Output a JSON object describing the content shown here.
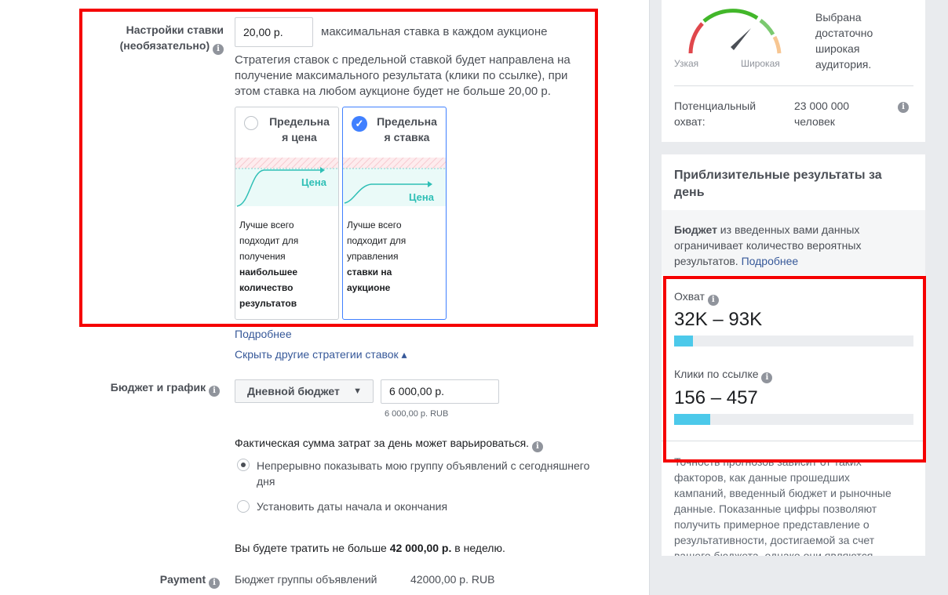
{
  "bid": {
    "label_line1": "Настройки ставки",
    "label_line2": "(необязательно)",
    "input_value": "20,00 р.",
    "input_suffix": "максимальная ставка в каждом аукционе",
    "description": [
      "Стратегия ставок с предельной ставкой будет направлена на",
      "получение максимального результата (клики по ссылке), при",
      "этом ставка на любом аукционе будет не больше 20,00 р."
    ],
    "cards": [
      {
        "title_line1": "Предельна",
        "title_line2": "я цена",
        "chart_label": "Цена",
        "desc_normal": [
          "Лучше всего",
          "подходит для",
          "получения"
        ],
        "desc_bold": [
          "наибольшее",
          "количество",
          "результатов"
        ],
        "selected": false
      },
      {
        "title_line1": "Предельна",
        "title_line2": "я ставка",
        "chart_label": "Цена",
        "desc_normal": [
          "Лучше всего",
          "подходит для",
          "управления"
        ],
        "desc_bold": [
          "ставки на",
          "аукционе"
        ],
        "selected": true
      }
    ],
    "more_link": "Подробнее",
    "hide_link": "Скрыть другие стратегии ставок ▴"
  },
  "budget": {
    "label": "Бюджет и график",
    "dropdown_value": "Дневной бюджет",
    "amount": "6 000,00 р.",
    "amount_sub": "6 000,00 р. RUB",
    "note": "Фактическая сумма затрат за день может варьироваться.",
    "options": [
      {
        "line1": "Непрерывно показывать мою группу объявлений с сегодняшнего",
        "line2": "дня",
        "selected": true
      },
      {
        "line1": "Установить даты начала и окончания",
        "line2": "",
        "selected": false
      }
    ],
    "weekly_prefix": "Вы будете тратить не больше",
    "weekly_amount": "42 000,00 р.",
    "weekly_suffix": "в неделю."
  },
  "payment": {
    "label": "Payment",
    "key": "Бюджет группы объявлений",
    "value": "42000,00 р. RUB"
  },
  "audience": {
    "gauge_narrow": "Узкая",
    "gauge_wide": "Широкая",
    "status": [
      "Выбрана",
      "достаточно",
      "широкая",
      "аудитория."
    ],
    "reach_label": [
      "Потенциальный",
      "охват:"
    ],
    "reach_value": [
      "23 000 000",
      "человек"
    ]
  },
  "results": {
    "title": [
      "Приблизительные результаты за",
      "день"
    ],
    "budget_note_bold": "Бюджет",
    "budget_note": [
      " из введенных вами данных",
      "ограничивает количество вероятных",
      "результатов. "
    ],
    "budget_note_link": "Подробнее",
    "metrics": [
      {
        "label": "Охват",
        "range": "32K – 93K",
        "fill_percent": 8
      },
      {
        "label": "Клики по ссылке",
        "range": "156 – 457",
        "fill_percent": 15
      }
    ],
    "accuracy": [
      "Точность прогнозов зависит от таких",
      "факторов, как данные прошедших",
      "кампаний, введенный бюджет и рыночные",
      "данные. Показанные цифры позволяют",
      "получить примерное представление о",
      "результативности, достигаемой за счет",
      "вашего бюджета, однако они являются"
    ]
  },
  "colors": {
    "highlight": "#f50000",
    "link": "#365899",
    "bar_fill": "#4cc9ea",
    "selected": "#4080ff",
    "chart_line": "#2fbfb6"
  }
}
